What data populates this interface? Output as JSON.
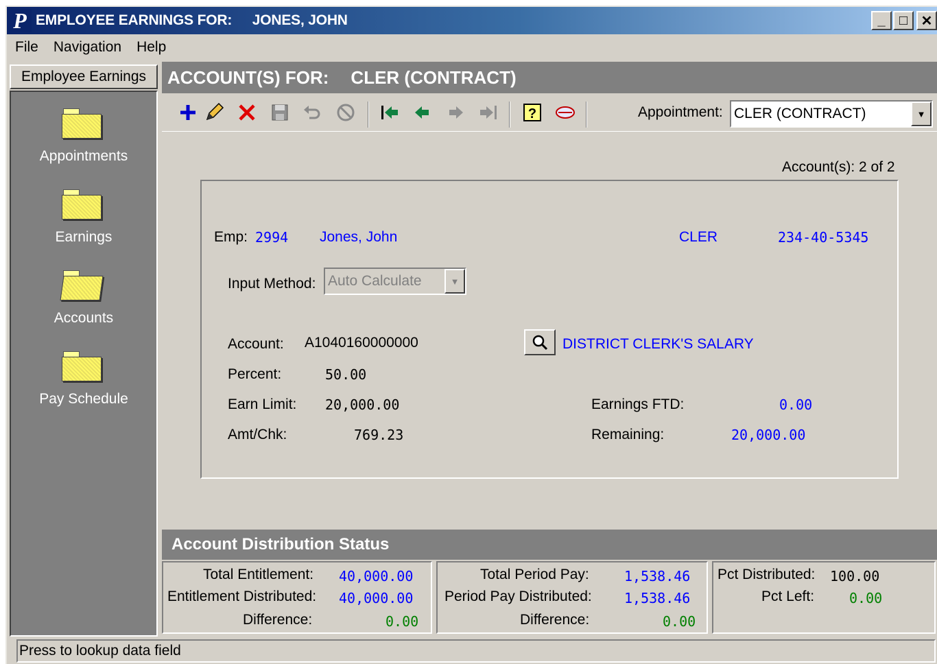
{
  "window": {
    "app_letter": "P",
    "title_prefix": "EMPLOYEE EARNINGS FOR:",
    "title_name": "JONES, JOHN",
    "controls": {
      "minimize": "_",
      "maximize": "□",
      "close": "✕"
    }
  },
  "menu": {
    "file": "File",
    "navigation": "Navigation",
    "help": "Help"
  },
  "sidebar": {
    "tab_label": "Employee Earnings",
    "items": [
      {
        "label": "Appointments",
        "icon": "folder-icon"
      },
      {
        "label": "Earnings",
        "icon": "folder-icon"
      },
      {
        "label": "Accounts",
        "icon": "open-folder-icon"
      },
      {
        "label": "Pay Schedule",
        "icon": "folder-icon"
      }
    ]
  },
  "header": {
    "prefix": "ACCOUNT(S) FOR:",
    "value": "CLER  (CONTRACT)"
  },
  "toolbar": {
    "buttons": [
      "add-icon",
      "edit-icon",
      "delete-icon",
      "save-icon",
      "undo-icon",
      "cancel-icon",
      "first-record-icon",
      "previous-record-icon",
      "next-record-icon",
      "last-record-icon",
      "help-icon",
      "web-icon"
    ],
    "appointment_label": "Appointment:",
    "appointment_value": "CLER  (CONTRACT)"
  },
  "accounts_count": "Account(s): 2 of 2",
  "employee": {
    "emp_label": "Emp:",
    "number": "2994",
    "name": "Jones, John",
    "code": "CLER",
    "ssn": "234-40-5345"
  },
  "input_method": {
    "label": "Input Method:",
    "value": "Auto Calculate"
  },
  "account": {
    "account_label": "Account:",
    "account_value": "A1040160000000",
    "description": "DISTRICT CLERK'S SALARY",
    "percent_label": "Percent:",
    "percent_value": "50.00",
    "earn_limit_label": "Earn Limit:",
    "earn_limit_value": "20,000.00",
    "amt_chk_label": "Amt/Chk:",
    "amt_chk_value": "769.23",
    "earnings_ftd_label": "Earnings FTD:",
    "earnings_ftd_value": "0.00",
    "remaining_label": "Remaining:",
    "remaining_value": "20,000.00"
  },
  "distribution": {
    "title": "Account Distribution Status",
    "total_entitlement_label": "Total Entitlement:",
    "total_entitlement_value": "40,000.00",
    "entitlement_distributed_label": "Entitlement Distributed:",
    "entitlement_distributed_value": "40,000.00",
    "difference1_label": "Difference:",
    "difference1_value": "0.00",
    "total_period_pay_label": "Total Period Pay:",
    "total_period_pay_value": "1,538.46",
    "period_pay_distributed_label": "Period Pay Distributed:",
    "period_pay_distributed_value": "1,538.46",
    "difference2_label": "Difference:",
    "difference2_value": "0.00",
    "pct_distributed_label": "Pct Distributed:",
    "pct_distributed_value": "100.00",
    "pct_left_label": "Pct Left:",
    "pct_left_value": "0.00"
  },
  "status_bar": "Press to lookup data field",
  "colors": {
    "link_blue": "#0000ff",
    "ok_green": "#008000",
    "panel_gray": "#808080"
  }
}
